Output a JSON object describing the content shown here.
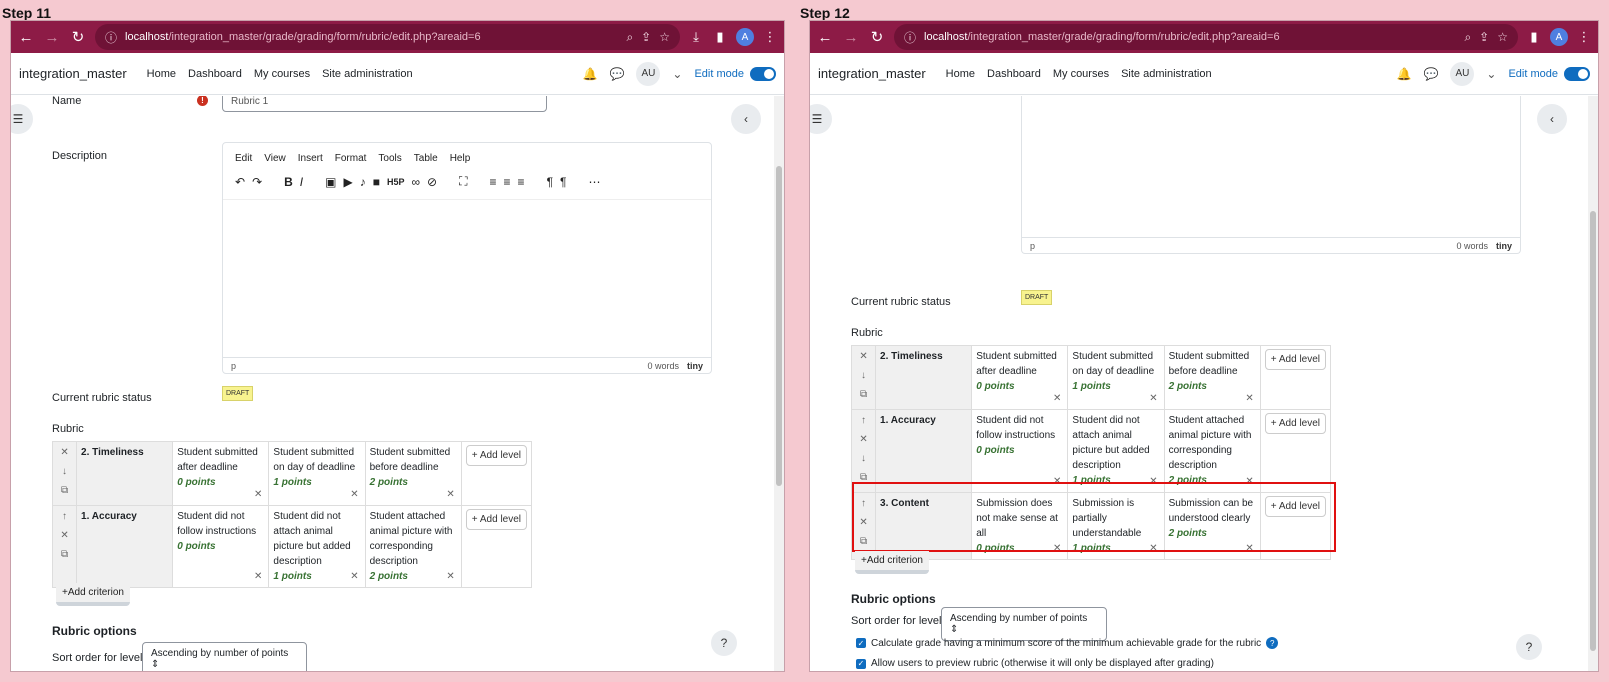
{
  "steps": [
    "Step 11",
    "Step 12"
  ],
  "browser": {
    "url_host": "localhost",
    "url_path": "/integration_master/grade/grading/form/rubric/edit.php?areaid=6",
    "profile_initial": "A"
  },
  "navbar": {
    "brand": "integration_master",
    "links": [
      "Home",
      "Dashboard",
      "My courses",
      "Site administration"
    ],
    "user_initials": "AU",
    "edit_mode": "Edit mode"
  },
  "form": {
    "name_label": "Name",
    "name_value": "Rubric 1",
    "description_label": "Description",
    "editor_menu": [
      "Edit",
      "View",
      "Insert",
      "Format",
      "Tools",
      "Table",
      "Help"
    ],
    "editor_path": "p",
    "editor_words": "0 words",
    "editor_brand": "tiny",
    "status_label": "Current rubric status",
    "status_badge": "DRAFT",
    "rubric_label": "Rubric"
  },
  "rubric": {
    "add_level": "Add level",
    "add_criterion": "Add criterion",
    "criteria": [
      {
        "title": "2. Timeliness",
        "levels": [
          {
            "text": "Student submitted after deadline",
            "points": "0 points"
          },
          {
            "text": "Student submitted on day of deadline",
            "points": "1 points"
          },
          {
            "text": "Student submitted before deadline",
            "points": "2 points"
          }
        ]
      },
      {
        "title": "1. Accuracy",
        "levels": [
          {
            "text": "Student did not follow instructions",
            "points": "0 points"
          },
          {
            "text": "Student did not attach animal picture but added description",
            "points": "1 points"
          },
          {
            "text": "Student attached animal picture with corresponding description",
            "points": "2 points"
          }
        ]
      },
      {
        "title": "3. Content",
        "levels": [
          {
            "text": "Submission does not make sense at all",
            "points": "0 points"
          },
          {
            "text": "Submission is partially understandable",
            "points": "1 points"
          },
          {
            "text": "Submission can be understood clearly",
            "points": "2 points"
          }
        ]
      }
    ]
  },
  "options": {
    "heading": "Rubric options",
    "sort_label": "Sort order for levels:",
    "sort_value": "Ascending by number of points",
    "check1": "Calculate grade having a minimum score of the minimum achievable grade for the rubric",
    "check2": "Allow users to preview rubric (otherwise it will only be displayed after grading)"
  },
  "colors": {
    "chrome": "#8d1b46",
    "points": "#387233",
    "highlight": "#e01010",
    "brand_blue": "#0f6cbf"
  }
}
